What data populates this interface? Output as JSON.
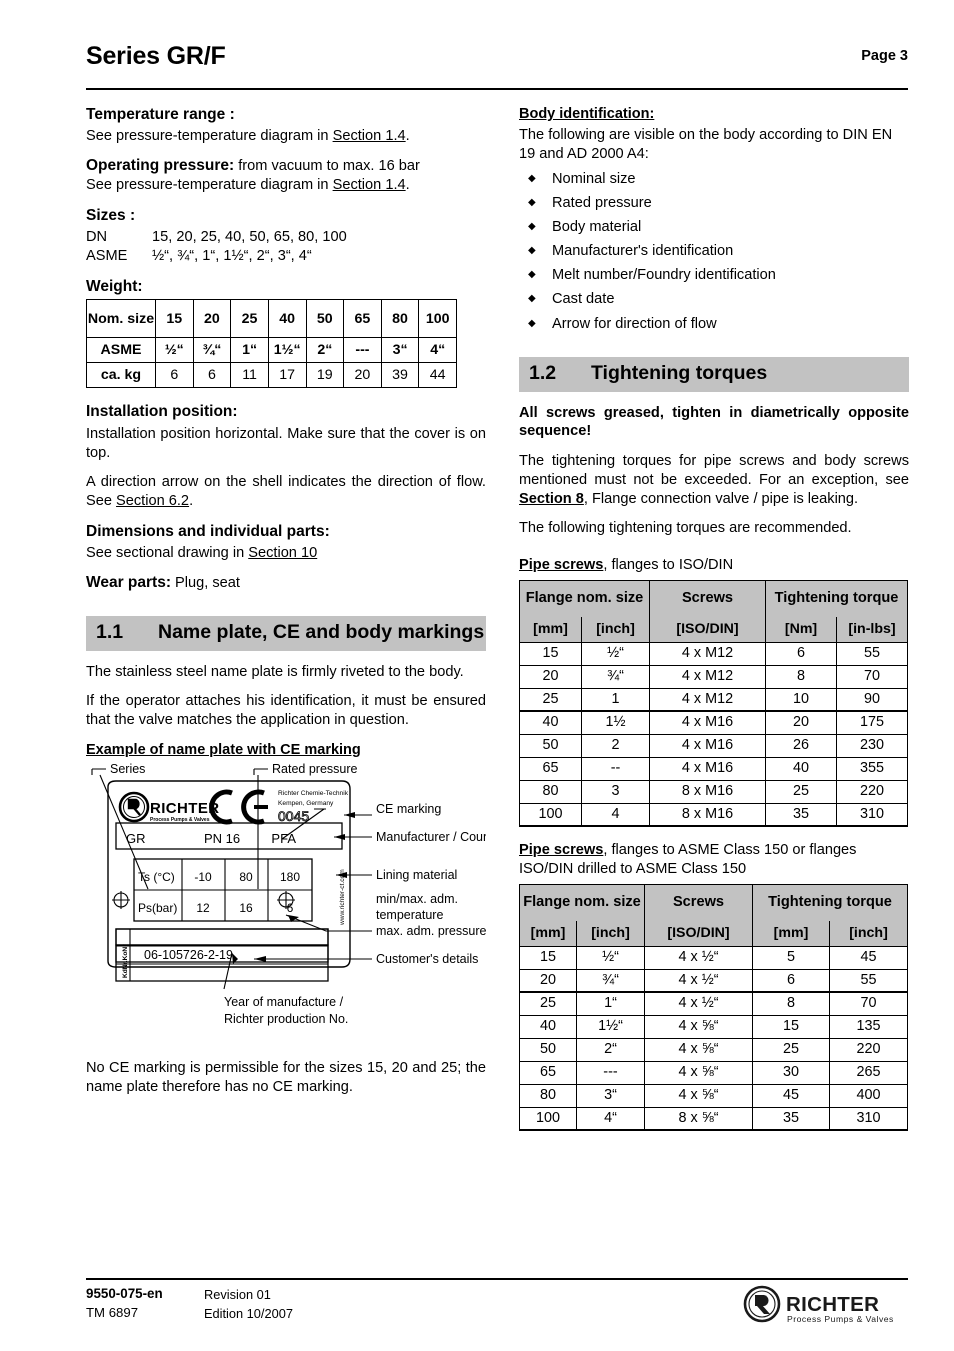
{
  "header": {
    "title": "Series GR/F",
    "page_label": "Page 3"
  },
  "left_column": {
    "temperature": {
      "heading": "Temperature range :",
      "text_before": "See pressure-temperature diagram in ",
      "link": "Section 1.4",
      "text_after": "."
    },
    "operating_pressure": {
      "heading": "Operating pressure:",
      "inline": " from vacuum to max. 16 bar",
      "text_before": "See pressure-temperature diagram in ",
      "link": "Section 1.4",
      "text_after": "."
    },
    "sizes": {
      "heading": "Sizes :",
      "rows": [
        {
          "label": "DN",
          "value": "15, 20, 25, 40, 50, 65, 80, 100"
        },
        {
          "label": "ASME",
          "value": "½“, ¾“, 1“, 1½“, 2“, 3“, 4“"
        }
      ]
    },
    "weight": {
      "heading": "Weight:",
      "table": {
        "rows": [
          {
            "header": "Nom. size",
            "cells": [
              "15",
              "20",
              "25",
              "40",
              "50",
              "65",
              "80",
              "100"
            ]
          },
          {
            "header": "ASME",
            "cells": [
              "½“",
              "¾“",
              "1“",
              "1½“",
              "2“",
              "---",
              "3“",
              "4“"
            ]
          },
          {
            "header": "ca. kg",
            "cells": [
              "6",
              "6",
              "11",
              "17",
              "19",
              "20",
              "39",
              "44"
            ]
          }
        ]
      }
    },
    "installation": {
      "heading": "Installation position:",
      "p1": "Installation position horizontal. Make sure that the cover is on top.",
      "p2_before": "A direction arrow on the shell indicates the direction of flow. See ",
      "p2_link": "Section 6.2",
      "p2_after": "."
    },
    "dimensions": {
      "heading": "Dimensions and individual parts:",
      "text_before": "See sectional drawing in ",
      "link": "Section 10"
    },
    "wear_parts": {
      "heading": "Wear parts:",
      "value": "  Plug, seat"
    },
    "section_1_1": {
      "number": "1.1",
      "title": "Name plate, CE and body markings",
      "p1": "The stainless steel name plate is firmly riveted to the body.",
      "p2": "If the operator attaches his identification, it must be ensured that the valve matches the application in question.",
      "example_heading": "Example of name plate with CE marking",
      "closing": "No CE marking is permissible for the sizes 15, 20 and 25; the name plate therefore has no CE marking."
    },
    "name_plate_figure": {
      "callouts": {
        "series": "Series",
        "rated_pressure": "Rated pressure",
        "ce_marking": "CE marking",
        "manufacturer_country": "Manufacturer / Country",
        "lining_material": "Lining material",
        "min_max_temp_line1": "min/max. adm.",
        "min_max_temp_line2": "temperature",
        "max_pressure": "max. adm. pressure",
        "customer_details": "Customer's details",
        "year_line1": "Year of manufacture /",
        "year_line2": "Richter production No."
      },
      "plate": {
        "brand": "RICHTER",
        "brand_sub": "Process Pumps & Valves",
        "manufacturer_line1": "Richter Chemie-Technik",
        "manufacturer_line2": "Kempen, Germany",
        "ce_number": "0045",
        "series_value": "GR",
        "pressure_value": "PN 16",
        "lining_value": "PFA",
        "temp_label": "Ts (°C)",
        "temp_values": [
          "-10",
          "80",
          "180"
        ],
        "press_label": "Ps(bar)",
        "press_values": [
          "12",
          "16",
          "6"
        ],
        "side_text": "www.richter-ct.com",
        "vertical_label": "KdNr.KoNr",
        "serial": "06-105726-2-19"
      }
    }
  },
  "right_column": {
    "body_identification": {
      "heading": "Body identification:",
      "intro": "The following are visible on the body according to DIN EN 19 and AD 2000 A4:",
      "items": [
        "Nominal size",
        "Rated pressure",
        "Body material",
        "Manufacturer's identification",
        "Melt number/Foundry identification",
        "Cast date",
        "Arrow for direction of flow"
      ]
    },
    "section_1_2": {
      "number": "1.2",
      "title": "Tightening torques",
      "warning": "All screws greased, tighten in diametrically opposite sequence!",
      "p1_a": "The tightening torques for pipe screws and body screws mentioned must not be exceeded. For an exception, see ",
      "p1_link": "Section 8",
      "p1_b": ", Flange connection valve / pipe is leaking.",
      "p2": "The following tightening torques are recommended."
    },
    "table_iso": {
      "caption_bold": "Pipe screws",
      "caption_rest": ", flanges to ISO/DIN",
      "group_headers": [
        "Flange nom. size",
        "Screws",
        "Tightening torque"
      ],
      "unit_headers": [
        "[mm]",
        "[inch]",
        "[ISO/DIN]",
        "[Nm]",
        "[in-lbs]"
      ],
      "rows": [
        [
          "15",
          "½“",
          "4 x M12",
          "6",
          "55"
        ],
        [
          "20",
          "¾“",
          "4 x M12",
          "8",
          "70"
        ],
        [
          "25",
          "1",
          "4 x M12",
          "10",
          "90"
        ],
        [
          "40",
          "1½",
          "4 x M16",
          "20",
          "175"
        ],
        [
          "50",
          "2",
          "4 x M16",
          "26",
          "230"
        ],
        [
          "65",
          "--",
          "4 x M16",
          "40",
          "355"
        ],
        [
          "80",
          "3",
          "8 x M16",
          "25",
          "220"
        ],
        [
          "100",
          "4",
          "8 x M16",
          "35",
          "310"
        ]
      ]
    },
    "table_asme": {
      "caption_bold": "Pipe screws",
      "caption_rest": ", flanges to ASME Class 150 or flanges ISO/DIN drilled to ASME Class 150",
      "group_headers": [
        "Flange nom. size",
        "Screws",
        "Tightening torque"
      ],
      "unit_headers": [
        "[mm]",
        "[inch]",
        "[ISO/DIN]",
        "[mm]",
        "[inch]"
      ],
      "rows": [
        [
          "15",
          "½“",
          "4 x ½“",
          "5",
          "45"
        ],
        [
          "20",
          "¾“",
          "4 x ½“",
          "6",
          "55"
        ],
        [
          "25",
          "1“",
          "4 x ½“",
          "8",
          "70"
        ],
        [
          "40",
          "1½“",
          "4 x ⅝“",
          "15",
          "135"
        ],
        [
          "50",
          "2“",
          "4 x ⅝“",
          "25",
          "220"
        ],
        [
          "65",
          "---",
          "4 x ⅝“",
          "30",
          "265"
        ],
        [
          "80",
          "3“",
          "4 x ⅝“",
          "45",
          "400"
        ],
        [
          "100",
          "4“",
          "8 x ⅝“",
          "35",
          "310"
        ]
      ]
    }
  },
  "footer": {
    "doc_code": "9550-075-en",
    "tm": "TM 6897",
    "revision": "Revision 01",
    "edition": "Edition 10/2007",
    "logo_name": "RICHTER",
    "logo_tagline": "Process Pumps & Valves"
  }
}
